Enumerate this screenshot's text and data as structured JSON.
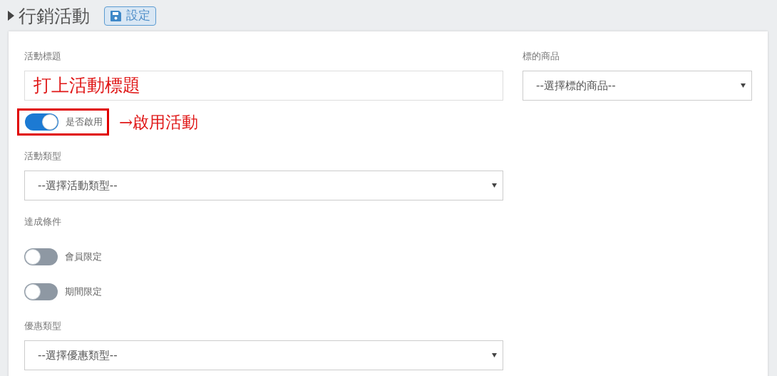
{
  "header": {
    "title": "行銷活動",
    "save_button": "設定"
  },
  "left_fields": [
    {
      "kind": "text",
      "label": "活動標題",
      "value": "打上活動標題"
    },
    {
      "kind": "toggle",
      "label": "是否啟用",
      "on": true,
      "annotation": "→啟用活動"
    },
    {
      "kind": "select",
      "label": "活動類型",
      "value": "--選擇活動類型--"
    },
    {
      "kind": "heading",
      "label": "達成條件"
    },
    {
      "kind": "toggle",
      "label": "會員限定",
      "on": false
    },
    {
      "kind": "toggle",
      "label": "期間限定",
      "on": false
    },
    {
      "kind": "select",
      "label": "優惠類型",
      "value": "--選擇優惠類型--"
    }
  ],
  "right_fields": [
    {
      "kind": "select",
      "label": "標的商品",
      "value": "--選擇標的商品--"
    }
  ]
}
